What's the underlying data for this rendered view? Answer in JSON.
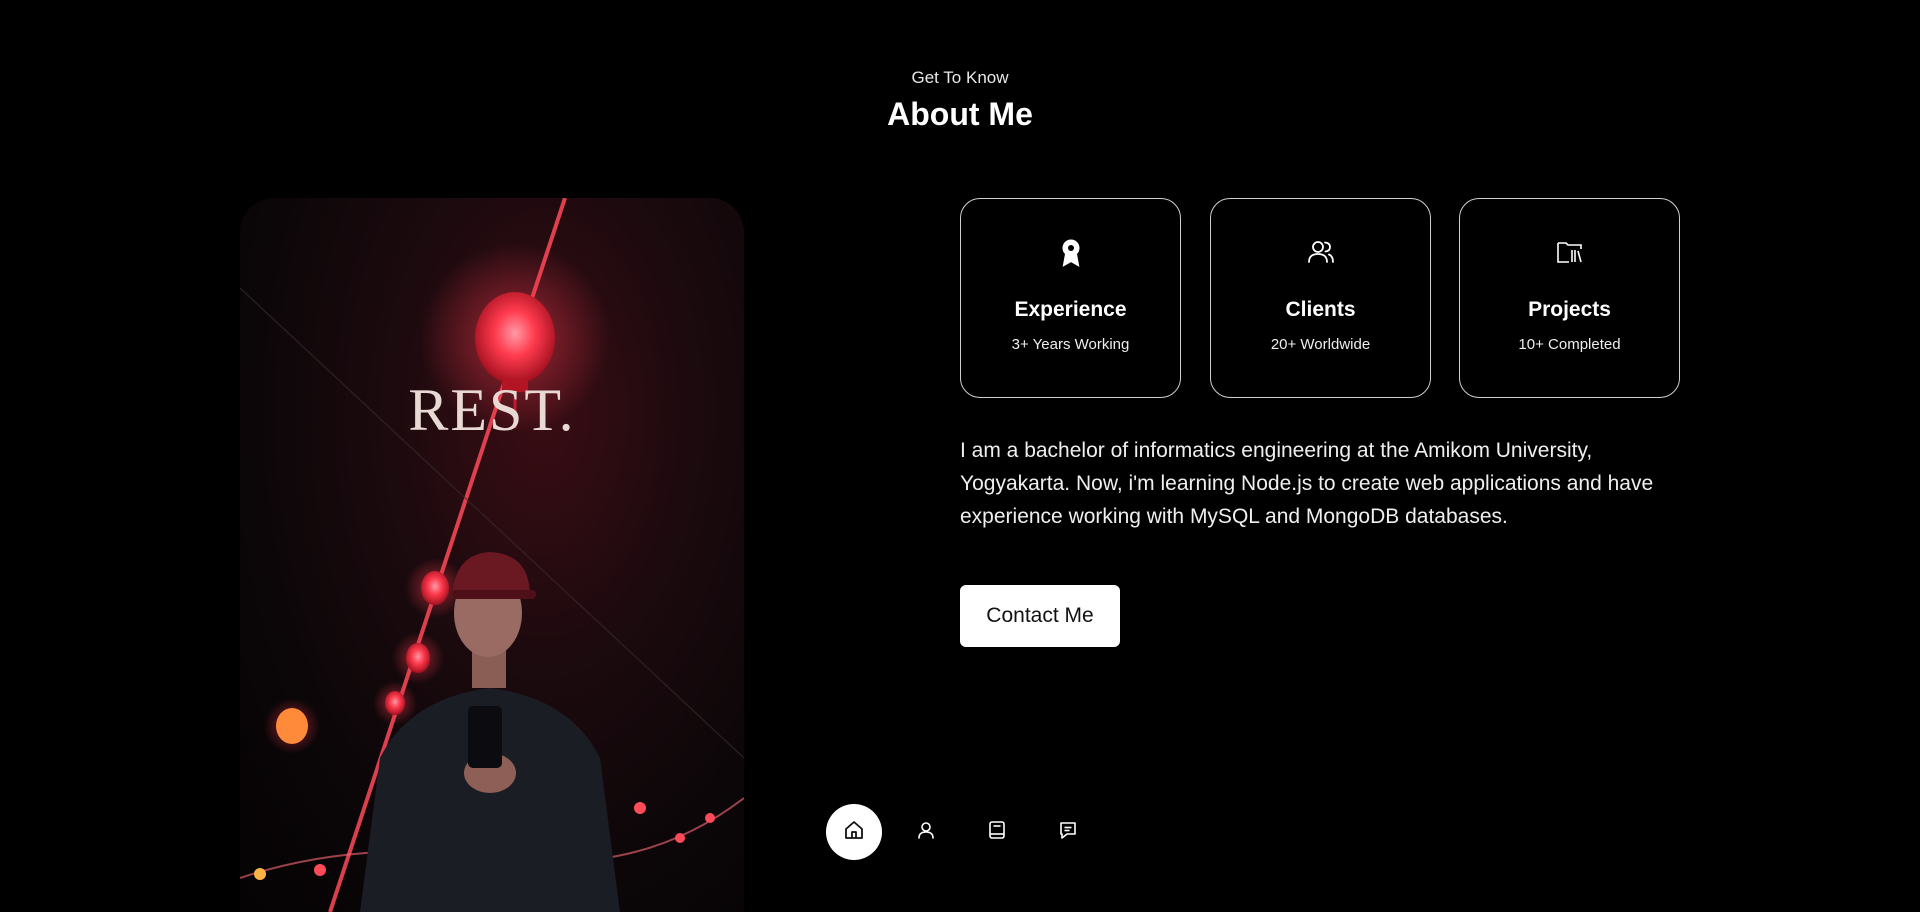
{
  "header": {
    "eyebrow": "Get To Know",
    "title": "About Me"
  },
  "photo": {
    "overlay_text": "REST."
  },
  "cards": [
    {
      "icon": "award-icon",
      "title": "Experience",
      "subtitle": "3+ Years Working"
    },
    {
      "icon": "users-icon",
      "title": "Clients",
      "subtitle": "20+ Worldwide"
    },
    {
      "icon": "folder-library-icon",
      "title": "Projects",
      "subtitle": "10+ Completed"
    }
  ],
  "about": {
    "text": "I am a bachelor of informatics engineering at the Amikom University, Yogyakarta. Now, i'm learning Node.js to create web applications and have experience working with MySQL and MongoDB databases."
  },
  "contact_button": {
    "label": "Contact Me"
  },
  "nav": {
    "items": [
      {
        "icon": "home-icon",
        "active": true
      },
      {
        "icon": "user-icon",
        "active": false
      },
      {
        "icon": "book-icon",
        "active": false
      },
      {
        "icon": "message-icon",
        "active": false
      }
    ]
  },
  "colors": {
    "background": "#000000",
    "text": "#ffffff",
    "card_border": "#cfcfcf",
    "button_bg": "#ffffff",
    "lantern_red": "#ff3b4e"
  }
}
